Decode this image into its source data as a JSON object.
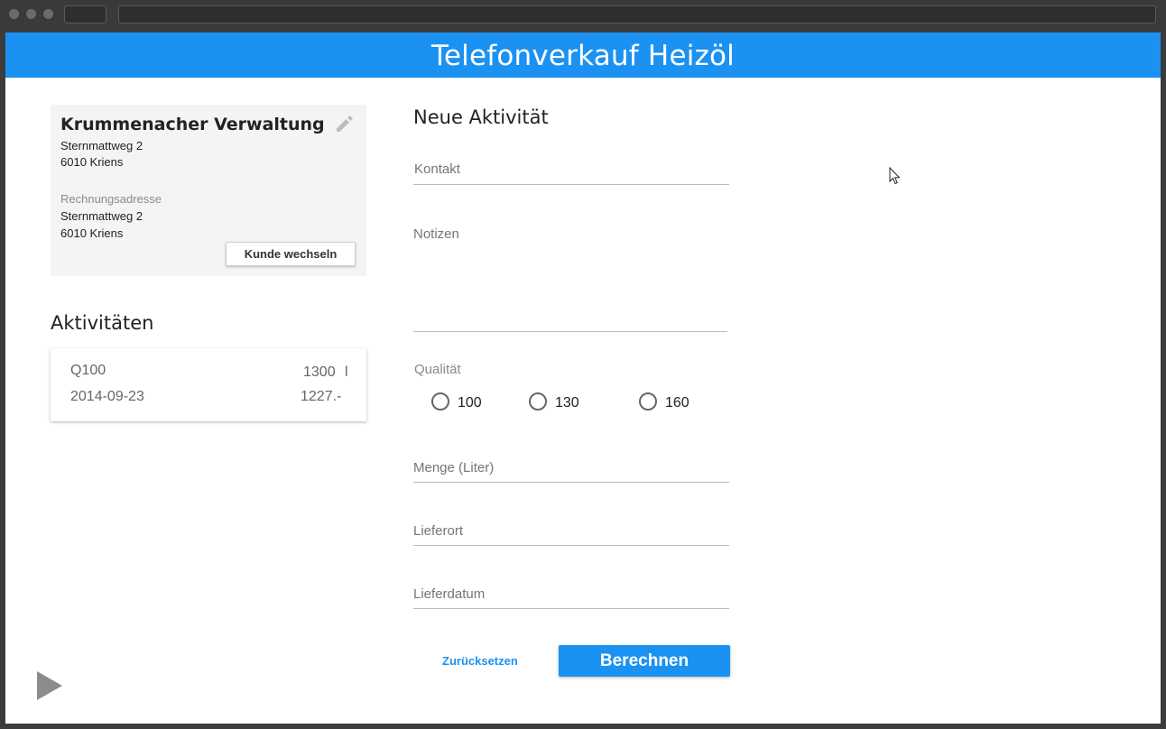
{
  "header": {
    "title": "Telefonverkauf Heizöl"
  },
  "customer": {
    "name": "Krummenacher Verwaltung",
    "street": "Sternmattweg 2",
    "city": "6010 Kriens",
    "billing_label": "Rechnungsadresse",
    "billing_street": "Sternmattweg 2",
    "billing_city": "6010 Kriens",
    "change_button": "Kunde wechseln"
  },
  "activities": {
    "heading": "Aktivitäten",
    "items": [
      {
        "quality": "Q100",
        "quantity": "1300",
        "unit": "l",
        "date": "2014-09-23",
        "price": "1227.-"
      }
    ]
  },
  "form": {
    "heading": "Neue Aktivität",
    "kontakt": "Kontakt",
    "notizen": "Notizen",
    "qualitaet": "Qualität",
    "options": [
      "100",
      "130",
      "160"
    ],
    "menge": "Menge (Liter)",
    "lieferort": "Lieferort",
    "lieferdatum": "Lieferdatum",
    "reset": "Zurücksetzen",
    "submit": "Berechnen"
  },
  "colors": {
    "primary": "#1b92f1",
    "card_bg": "#f4f4f4"
  },
  "icons": {
    "edit": "pencil-icon",
    "play": "play-icon",
    "cursor": "mouse-cursor-icon"
  }
}
